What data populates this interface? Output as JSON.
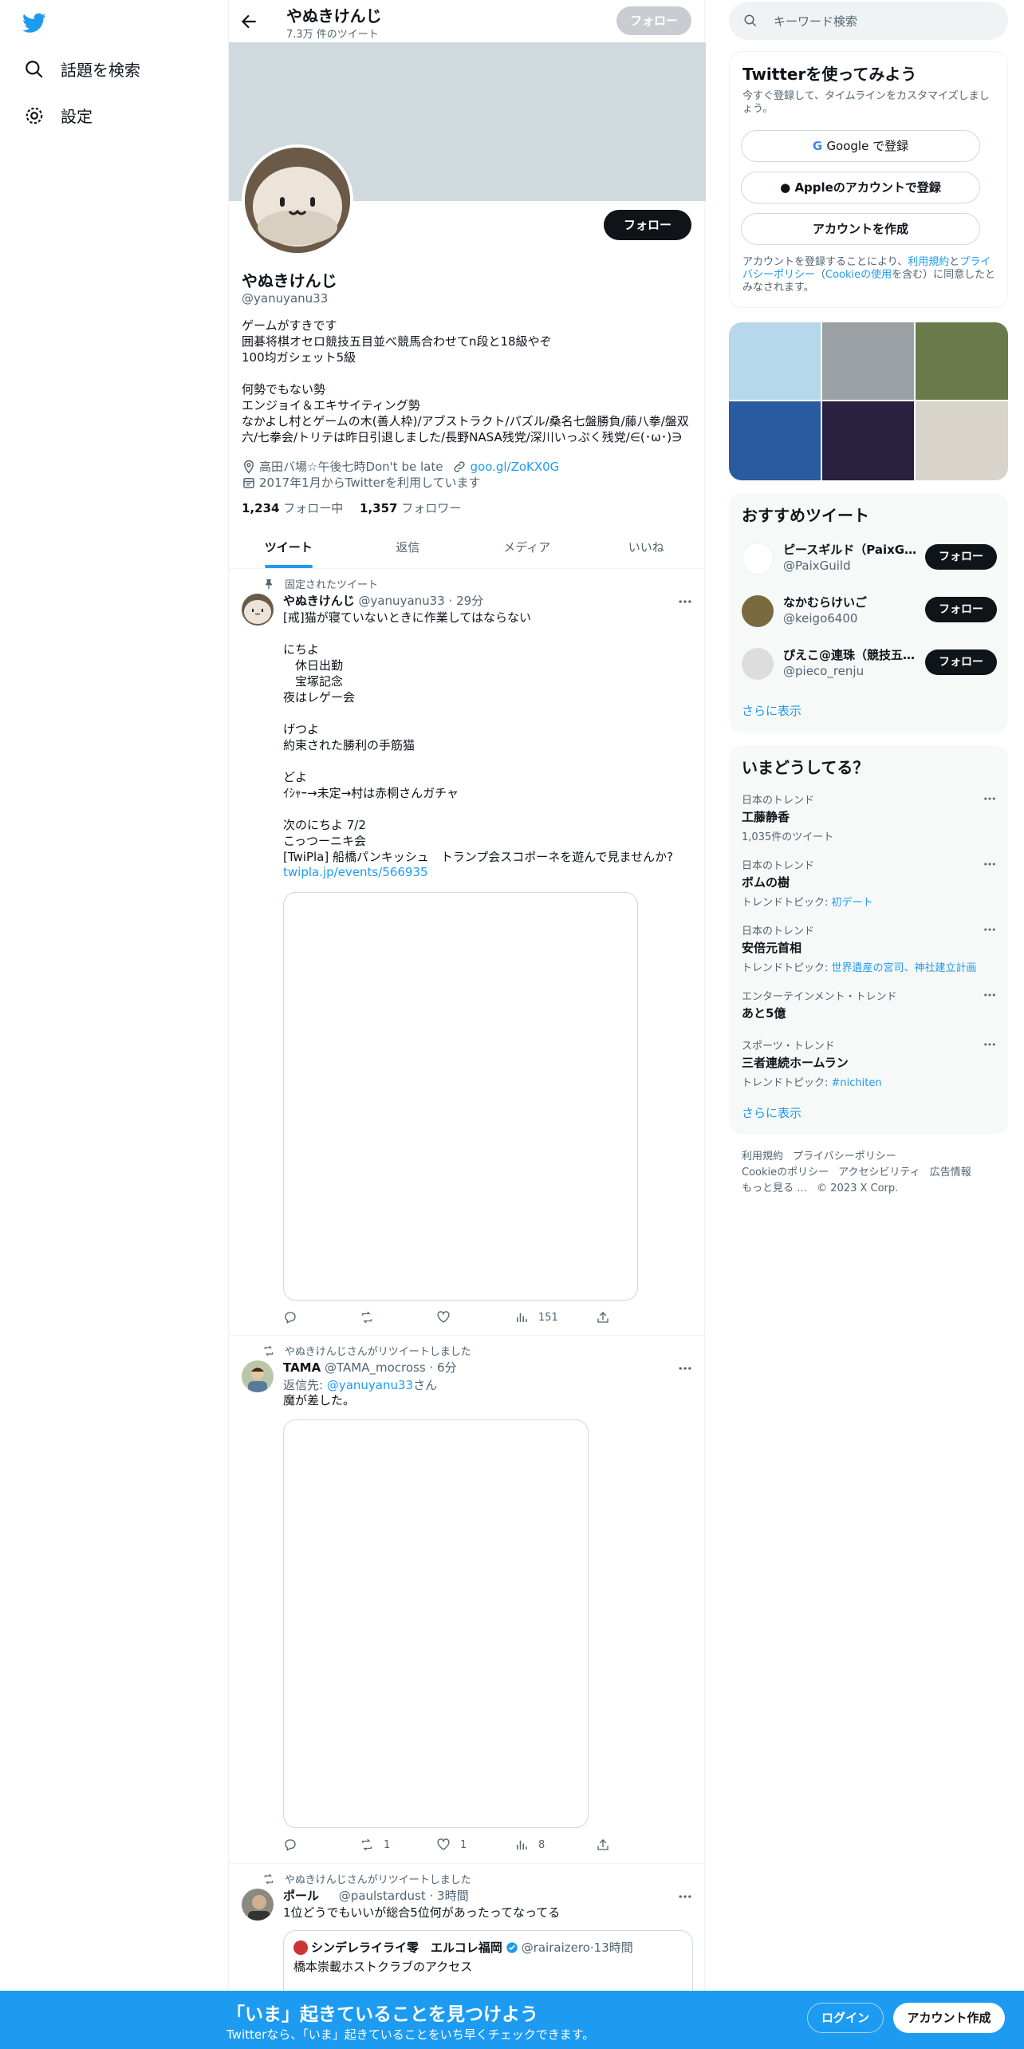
{
  "left_nav": {
    "items": [
      {
        "label": "話題を検索",
        "icon": "search-icon"
      },
      {
        "label": "設定",
        "icon": "gear-icon"
      }
    ]
  },
  "profile_header": {
    "name": "やぬきけんじ",
    "tweet_count": "7.3万 件のツイート",
    "follow_label": "フォロー"
  },
  "profile": {
    "name": "やぬきけんじ",
    "handle": "@yanuyanu33",
    "follow_label": "フォロー",
    "bio": "ゲームがすきです\n囲碁将棋オセロ競技五目並べ競馬合わせてn段と18級やぞ\n100均ガシェット5級\n\n何勢でもない勢\nエンジョイ＆エキサイティング勢\nなかよし村とゲームの木(善人枠)/アブストラクト/パズル/桑名七盤勝負/藤八拳/盤双六/七拳会/トリテは昨日引退しました/長野NASA残党/深川いっぷく残党/∈(･ω･)∋",
    "location": "高田バ場☆午後七時Don't be late",
    "link": "goo.gl/ZoKX0G",
    "joined": "2017年1月からTwitterを利用しています",
    "following_count": "1,234",
    "following_label": "フォロー中",
    "followers_count": "1,357",
    "followers_label": "フォロワー"
  },
  "tabs": [
    "ツイート",
    "返信",
    "メディア",
    "いいね"
  ],
  "tweets": [
    {
      "context": "固定されたツイート",
      "name": "やぬきけんじ",
      "handle": "@yanuyanu33",
      "time": "29分",
      "text": "[戒]猫が寝ていないときに作業してはならない\n\nにちよ\n　休日出勤\n　宝塚記念\n夜はレゲー会\n\nげつよ\n約束された勝利の手筋猫\n\nどよ\nｲｼｬｰ→未定→村は赤桐さんガチャ\n\n次のにちよ 7/2\nこっつーニキ会\n[TwiPla] 船橋パンキッシュ　トランプ会スコポーネを遊んで見ませんか?",
      "link": "twipla.jp/events/566935",
      "retweets": "",
      "likes": "",
      "views": "151"
    },
    {
      "context": "やぬきけんじさんがリツイートしました",
      "name": "TAMA",
      "handle": "@TAMA_mocross",
      "time": "6分",
      "reply_prefix": "返信先: ",
      "reply_to": "@yanuyanu33",
      "reply_suffix": "さん",
      "text": "魔が差した。",
      "retweets": "1",
      "likes": "1",
      "views": "8"
    },
    {
      "context": "やぬきけんじさんがリツイートしました",
      "name": "ポール",
      "handle": "@paulstardust",
      "time": "3時間",
      "text": "1位どうでもいいが総合5位何があったってなってる",
      "quote": {
        "name": "シンデレライライ零　エルコレ福岡",
        "handle": "@rairaizero",
        "time": "13時間",
        "text": "橋本崇載ホストクラブのアクセス"
      }
    }
  ],
  "search": {
    "placeholder": "キーワード検索"
  },
  "signup_card": {
    "title": "Twitterを使ってみよう",
    "subtitle": "今すぐ登録して、タイムラインをカスタマイズしましょう。",
    "google_label": "Google で登録",
    "apple_label": "Appleのアカウントで登録",
    "create_label": "アカウントを作成",
    "legal_1": "アカウントを登録することにより、",
    "terms": "利用規約",
    "legal_2": "と",
    "privacy": "プライバシーポリシー",
    "legal_3": "（",
    "cookie": "Cookieの使用",
    "legal_4": "を含む）に同意したとみなされます。"
  },
  "recommended": {
    "title": "おすすめツイート",
    "users": [
      {
        "name": "ピースギルド（PaixGuild）",
        "handle": "@PaixGuild"
      },
      {
        "name": "なかむらけいご",
        "handle": "@keigo6400"
      },
      {
        "name": "ぴえこ@連珠（競技五目並べ）",
        "handle": "@pieco_renju"
      }
    ],
    "follow_label": "フォロー",
    "show_more": "さらに表示"
  },
  "trends": {
    "title": "いまどうしてる？",
    "items": [
      {
        "category": "日本のトレンド",
        "name": "工藤静香",
        "sub": "1,035件のツイート",
        "sub_link": ""
      },
      {
        "category": "日本のトレンド",
        "name": "ボムの樹",
        "sub": "トレンドトピック: ",
        "sub_link": "初デート"
      },
      {
        "category": "日本のトレンド",
        "name": "安倍元首相",
        "sub": "トレンドトピック: ",
        "sub_link": "世界遺産の宮司、神社建立計画"
      },
      {
        "category": "エンターテインメント・トレンド",
        "name": "あと5億",
        "sub": "",
        "sub_link": ""
      },
      {
        "category": "スポーツ・トレンド",
        "name": "三者連続ホームラン",
        "sub": "トレンドトピック: ",
        "sub_link": "#nichiten"
      }
    ],
    "show_more": "さらに表示"
  },
  "footer": {
    "links": [
      "利用規約",
      "プライバシーポリシー",
      "Cookieのポリシー",
      "アクセシビリティ",
      "広告情報",
      "もっと見る …"
    ],
    "copyright": "© 2023 X Corp."
  },
  "bottom_bar": {
    "title": "「いま」起きていることを見つけよう",
    "subtitle": "Twitterなら、「いま」起きていることをいち早くチェックできます。",
    "login": "ログイン",
    "signup": "アカウント作成"
  },
  "colors": {
    "accent": "#1d9bf0",
    "text": "#0f1419",
    "secondary": "#536471"
  }
}
